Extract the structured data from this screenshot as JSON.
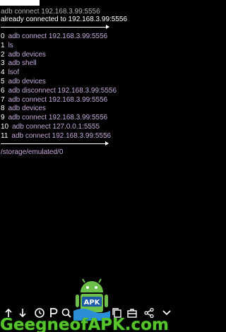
{
  "terminal": {
    "current_command": "adb connect 192.168.3.99:5556",
    "output": "already connected to 192.168.3.99:5556",
    "history": [
      {
        "index": "0",
        "command": "adb connect 192.168.3.99:5556"
      },
      {
        "index": "1",
        "command": "ls"
      },
      {
        "index": "2",
        "command": "adb devices"
      },
      {
        "index": "3",
        "command": "adb shell"
      },
      {
        "index": "4",
        "command": "lsof"
      },
      {
        "index": "5",
        "command": "adb devices"
      },
      {
        "index": "6",
        "command": "adb disconnect 192.168.3.99:5556"
      },
      {
        "index": "7",
        "command": "adb connect 192.168.3.99:5556"
      },
      {
        "index": "8",
        "command": "adb devices"
      },
      {
        "index": "9",
        "command": "adb connect 192.168.3.99:5556"
      },
      {
        "index": "10",
        "command": "adb connect 127.0.0.1:5555"
      },
      {
        "index": "11",
        "command": "adb connect 192.168.3.99:5556"
      }
    ],
    "path": "/storage/emulated/0"
  },
  "toolbar": {
    "icons": [
      "share-up-icon",
      "scroll-down-icon",
      "clock-icon",
      "p-icon",
      "search-icon",
      "copy-icon",
      "briefcase-icon",
      "share-icon",
      "chevron-down-icon"
    ]
  },
  "watermark": {
    "text": "GeegneofAPK.com",
    "badge": "APK"
  },
  "colors": {
    "background": "#000000",
    "command": "#c2a8d8",
    "text": "#ffffff",
    "watermark": "#57c52b"
  }
}
